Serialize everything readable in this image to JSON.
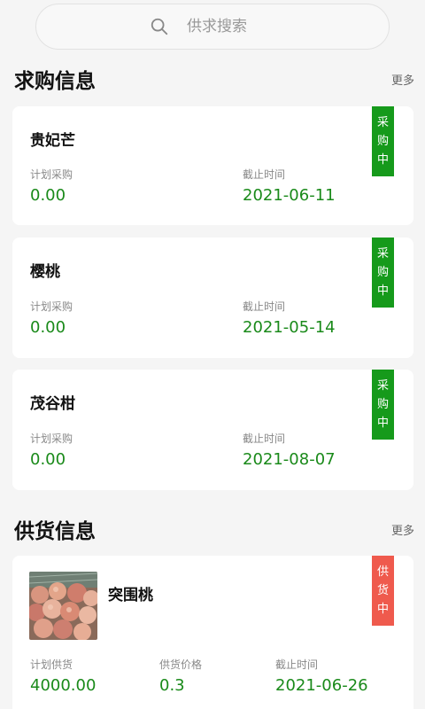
{
  "search": {
    "placeholder": "供求搜索"
  },
  "purchase_section": {
    "title": "求购信息",
    "more": "更多",
    "items": [
      {
        "name": "贵妃芒",
        "plan_label": "计划采购",
        "plan_value": "0.00",
        "deadline_label": "截止时间",
        "deadline_value": "2021-06-11",
        "status": [
          "采",
          "购",
          "中"
        ]
      },
      {
        "name": "樱桃",
        "plan_label": "计划采购",
        "plan_value": "0.00",
        "deadline_label": "截止时间",
        "deadline_value": "2021-05-14",
        "status": [
          "采",
          "购",
          "中"
        ]
      },
      {
        "name": "茂谷柑",
        "plan_label": "计划采购",
        "plan_value": "0.00",
        "deadline_label": "截止时间",
        "deadline_value": "2021-08-07",
        "status": [
          "采",
          "购",
          "中"
        ]
      }
    ]
  },
  "supply_section": {
    "title": "供货信息",
    "more": "更多",
    "items": [
      {
        "name": "突围桃",
        "plan_label": "计划供货",
        "plan_value": "4000.00",
        "price_label": "供货价格",
        "price_value": "0.3",
        "deadline_label": "截止时间",
        "deadline_value": "2021-06-26",
        "status": [
          "供",
          "货",
          "中"
        ],
        "image": "peaches-photo"
      }
    ]
  },
  "colors": {
    "accent_green": "#1a8a1a",
    "badge_green": "#169a1b",
    "badge_red": "#ef5a4d",
    "background": "#f5f5f5"
  }
}
